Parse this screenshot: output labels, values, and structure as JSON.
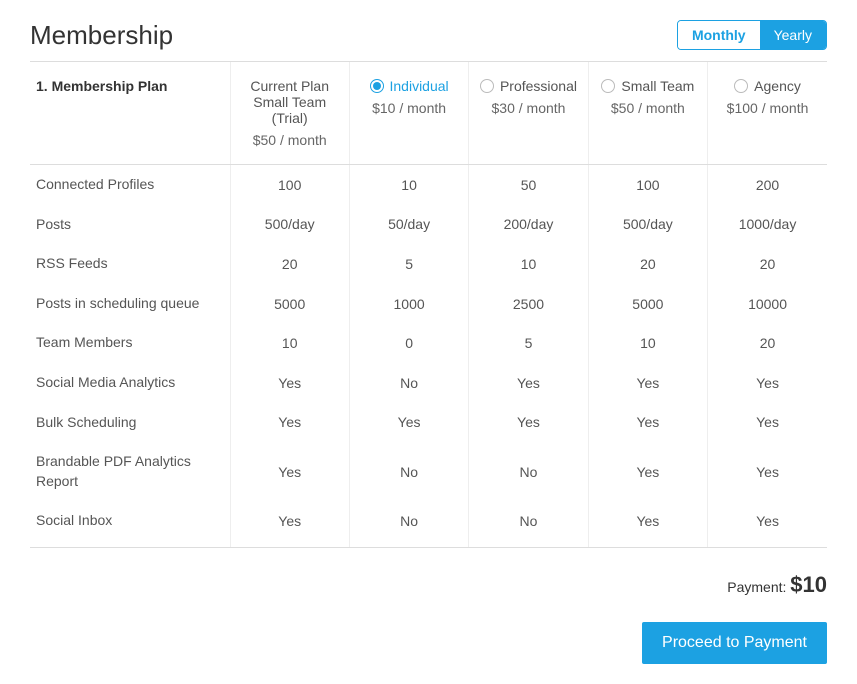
{
  "page": {
    "title": "Membership",
    "section_label": "1. Membership Plan"
  },
  "billing_toggle": {
    "monthly": "Monthly",
    "yearly": "Yearly",
    "active": "Monthly"
  },
  "plans": {
    "current": {
      "label_line1": "Current Plan",
      "label_line2": "Small Team (Trial)",
      "price": "$50 / month"
    },
    "individual": {
      "name": "Individual",
      "price": "$10 / month"
    },
    "professional": {
      "name": "Professional",
      "price": "$30 / month"
    },
    "small_team": {
      "name": "Small Team",
      "price": "$50 / month"
    },
    "agency": {
      "name": "Agency",
      "price": "$100 / month"
    },
    "selected": "individual"
  },
  "features": [
    {
      "label": "Connected Profiles",
      "current": "100",
      "individual": "10",
      "professional": "50",
      "small_team": "100",
      "agency": "200"
    },
    {
      "label": "Posts",
      "current": "500/day",
      "individual": "50/day",
      "professional": "200/day",
      "small_team": "500/day",
      "agency": "1000/day"
    },
    {
      "label": "RSS Feeds",
      "current": "20",
      "individual": "5",
      "professional": "10",
      "small_team": "20",
      "agency": "20"
    },
    {
      "label": "Posts in scheduling queue",
      "current": "5000",
      "individual": "1000",
      "professional": "2500",
      "small_team": "5000",
      "agency": "10000"
    },
    {
      "label": "Team Members",
      "current": "10",
      "individual": "0",
      "professional": "5",
      "small_team": "10",
      "agency": "20"
    },
    {
      "label": "Social Media Analytics",
      "current": "Yes",
      "individual": "No",
      "professional": "Yes",
      "small_team": "Yes",
      "agency": "Yes"
    },
    {
      "label": "Bulk Scheduling",
      "current": "Yes",
      "individual": "Yes",
      "professional": "Yes",
      "small_team": "Yes",
      "agency": "Yes"
    },
    {
      "label": "Brandable PDF Analytics Report",
      "current": "Yes",
      "individual": "No",
      "professional": "No",
      "small_team": "Yes",
      "agency": "Yes"
    },
    {
      "label": "Social Inbox",
      "current": "Yes",
      "individual": "No",
      "professional": "No",
      "small_team": "Yes",
      "agency": "Yes"
    }
  ],
  "payment": {
    "label": "Payment:",
    "amount": "$10",
    "proceed_label": "Proceed to Payment"
  }
}
